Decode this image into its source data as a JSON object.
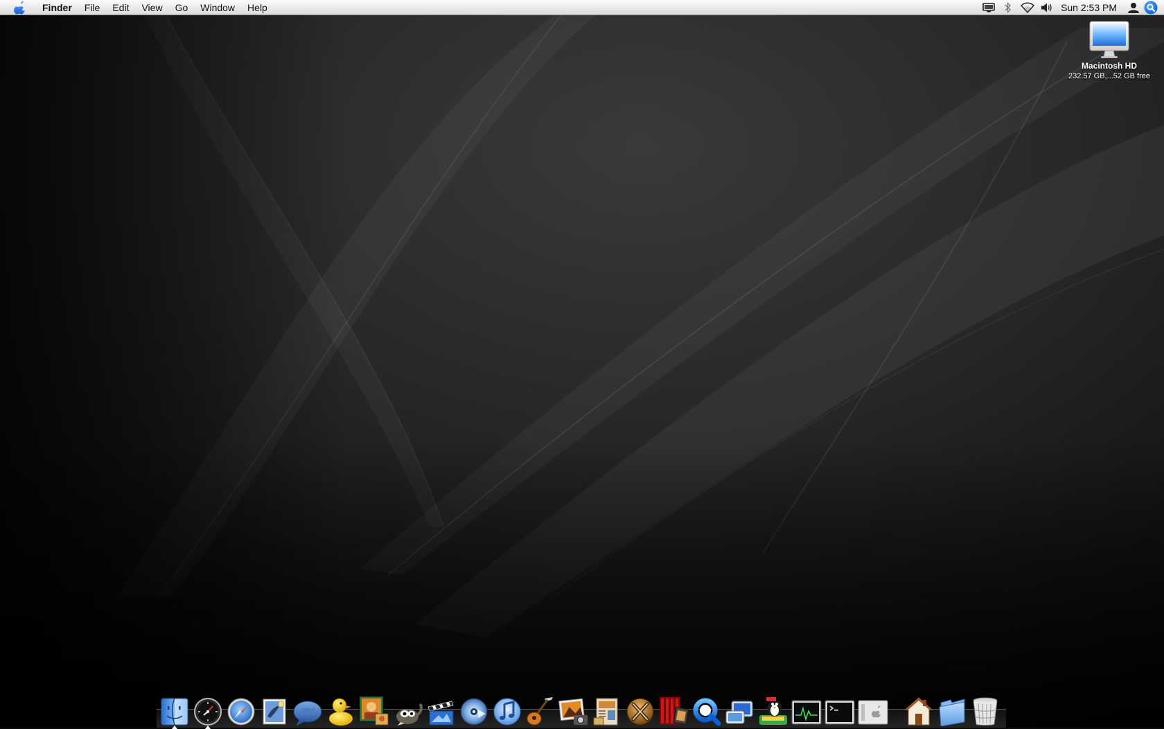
{
  "menubar": {
    "apple_icon": "apple-icon",
    "menus": [
      {
        "id": "finder",
        "label": "Finder",
        "bold": true
      },
      {
        "id": "file",
        "label": "File"
      },
      {
        "id": "edit",
        "label": "Edit"
      },
      {
        "id": "view",
        "label": "View"
      },
      {
        "id": "go",
        "label": "Go"
      },
      {
        "id": "window",
        "label": "Window"
      },
      {
        "id": "help",
        "label": "Help"
      }
    ],
    "extras": [
      "display-icon",
      "bluetooth-icon",
      "wifi-icon",
      "volume-icon"
    ],
    "clock": "Sun 2:53 PM",
    "user_icon": "user-icon",
    "spotlight_icon": "spotlight-icon"
  },
  "desktop": {
    "icons": [
      {
        "name": "Macintosh HD",
        "info": "232.57 GB,...52 GB free",
        "icon": "imac-icon"
      }
    ]
  },
  "dock": {
    "apps": [
      {
        "id": "finder",
        "icon": "finder-icon",
        "running": true
      },
      {
        "id": "dashboard",
        "icon": "dashboard-icon",
        "running": true
      },
      {
        "id": "safari",
        "icon": "safari-icon"
      },
      {
        "id": "mail",
        "icon": "mail-icon"
      },
      {
        "id": "ichat",
        "icon": "ichat-icon"
      },
      {
        "id": "cyberduck",
        "icon": "cyberduck-icon"
      },
      {
        "id": "photo-booth",
        "icon": "photo-booth-icon"
      },
      {
        "id": "gimp",
        "icon": "gimp-icon"
      },
      {
        "id": "imovie",
        "icon": "imovie-icon"
      },
      {
        "id": "dvd-player",
        "icon": "dvd-player-icon"
      },
      {
        "id": "itunes",
        "icon": "itunes-icon"
      },
      {
        "id": "garageband",
        "icon": "garageband-icon"
      },
      {
        "id": "iphoto",
        "icon": "iphoto-icon"
      },
      {
        "id": "iweb",
        "icon": "iweb-icon"
      },
      {
        "id": "x11",
        "icon": "x11-icon"
      },
      {
        "id": "front-row",
        "icon": "front-row-icon"
      },
      {
        "id": "quicktime",
        "icon": "quicktime-icon"
      },
      {
        "id": "vmware",
        "icon": "vmware-icon"
      },
      {
        "id": "penguin",
        "icon": "penguin-icon"
      },
      {
        "id": "activity-monitor",
        "icon": "activity-monitor-icon"
      },
      {
        "id": "terminal",
        "icon": "terminal-icon"
      },
      {
        "id": "system-profiler",
        "icon": "system-profiler-icon"
      }
    ],
    "places": [
      {
        "id": "home",
        "icon": "home-folder-icon"
      },
      {
        "id": "documents",
        "icon": "folder-icon"
      },
      {
        "id": "trash",
        "icon": "trash-icon"
      }
    ]
  }
}
